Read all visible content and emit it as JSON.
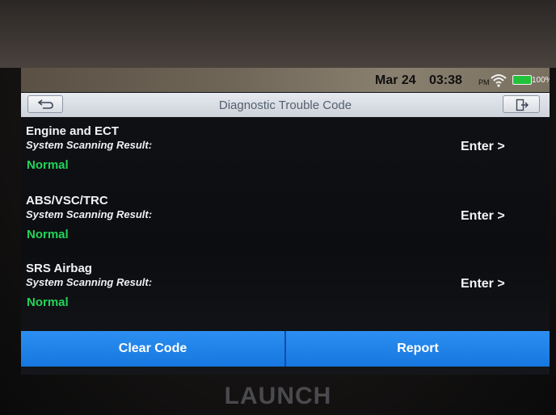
{
  "status_bar": {
    "date": "Mar 24",
    "time": "03:38",
    "ampm": "PM",
    "battery": "100%",
    "battery_color": "#22c33a"
  },
  "header": {
    "title": "Diagnostic Trouble Code",
    "back_icon": "back-arrow-icon",
    "exit_icon": "exit-icon"
  },
  "systems": [
    {
      "name": "Engine and ECT",
      "result_label": "System Scanning Result:",
      "status": "Normal",
      "action": "Enter >"
    },
    {
      "name": "ABS/VSC/TRC",
      "result_label": "System Scanning Result:",
      "status": "Normal",
      "action": "Enter >"
    },
    {
      "name": "SRS Airbag",
      "result_label": "System Scanning Result:",
      "status": "Normal",
      "action": "Enter >"
    }
  ],
  "footer": {
    "clear_code": "Clear Code",
    "report": "Report"
  },
  "brand": "LAUNCH",
  "colors": {
    "status_normal": "#22d45a",
    "button_blue": "#1677e0"
  }
}
